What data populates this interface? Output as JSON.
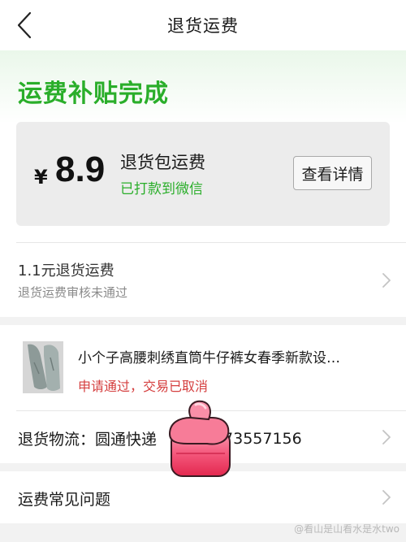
{
  "nav": {
    "title": "退货运费",
    "back_icon": "chevron-left-icon"
  },
  "hero": {
    "headline": "运费补贴完成",
    "card": {
      "currency": "¥",
      "amount": "8.9",
      "label": "退货包运费",
      "status": "已打款到微信",
      "detail_button": "查看详情"
    }
  },
  "claim": {
    "title": "1.1元退货运费",
    "subtitle": "退货运费审核未通过",
    "icon": "chevron-right-icon"
  },
  "order": {
    "product_name": "小个子高腰刺绣直筒牛仔裤女春季新款设…",
    "status": "申请通过，交易已取消",
    "logistics_label": "退货物流：",
    "carrier": "圆通快递",
    "tracking_suffix": "73557156",
    "icon": "chevron-right-icon"
  },
  "faq": {
    "title": "运费常见问题",
    "icon": "chevron-right-icon"
  },
  "watermark": "@看山是山看水是水two",
  "colors": {
    "accent_green": "#2aae2a",
    "alert_red": "#d53f3f",
    "sticker_pink": "#f2426a"
  }
}
